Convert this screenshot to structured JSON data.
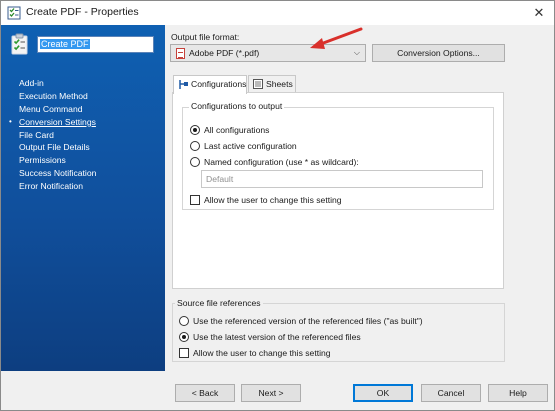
{
  "window": {
    "title": "Create PDF - Properties",
    "close_glyph": "✕",
    "icon": "task-checklist-icon"
  },
  "sidebar": {
    "name_value": "Create PDF",
    "active_bullet": "•",
    "items": [
      {
        "label": "Add-in"
      },
      {
        "label": "Execution Method"
      },
      {
        "label": "Menu Command"
      },
      {
        "label": "Conversion Settings"
      },
      {
        "label": "File Card"
      },
      {
        "label": "Output File Details"
      },
      {
        "label": "Permissions"
      },
      {
        "label": "Success Notification"
      },
      {
        "label": "Error Notification"
      }
    ],
    "active_index": 3
  },
  "output": {
    "label": "Output file format:",
    "selected_format": "Adobe PDF (*.pdf)",
    "conversion_options_label": "Conversion Options..."
  },
  "tabs": [
    {
      "label": "Configurations",
      "icon": "configuration-tree-icon",
      "selected": true
    },
    {
      "label": "Sheets",
      "icon": "sheet-icon",
      "selected": false
    }
  ],
  "configurations": {
    "group_title": "Configurations to output",
    "options": [
      {
        "label": "All configurations",
        "checked": true
      },
      {
        "label": "Last active configuration",
        "checked": false
      },
      {
        "label": "Named configuration (use * as wildcard):",
        "checked": false
      }
    ],
    "named_placeholder": "Default",
    "allow_change_label": "Allow the user to change this setting"
  },
  "source_refs": {
    "group_title": "Source file references",
    "options": [
      {
        "label": "Use the referenced version of the referenced files (\"as built\")",
        "checked": false
      },
      {
        "label": "Use the latest version of the referenced files",
        "checked": true
      }
    ],
    "allow_change_label": "Allow the user to change this setting"
  },
  "footer": {
    "back_label": "< Back",
    "next_label": "Next >",
    "ok_label": "OK",
    "cancel_label": "Cancel",
    "help_label": "Help"
  },
  "colors": {
    "sidebar_blue": "#0f60b2",
    "annotation_arrow": "#d9302b",
    "selection_blue": "#3398f0"
  }
}
